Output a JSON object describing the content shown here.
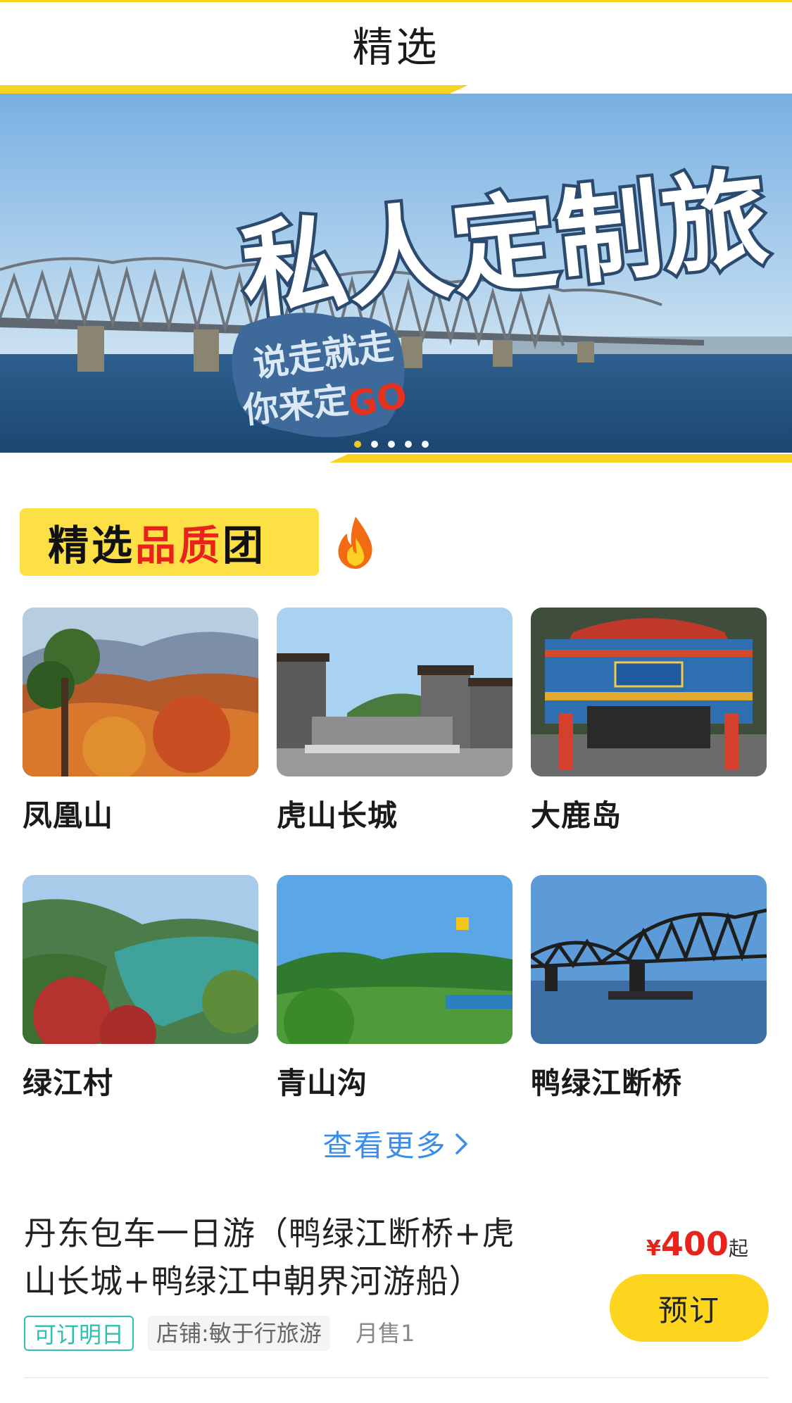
{
  "header": {
    "title": "精选"
  },
  "banner": {
    "main_text": "私人定制旅",
    "sub_text_1": "说走就走",
    "sub_text_2": "你来定",
    "go_text": "GO",
    "slide_count": 5,
    "active_slide": 1
  },
  "section": {
    "title_part1": "精选",
    "title_part2": "品质",
    "title_part3": "团"
  },
  "destinations": [
    {
      "name": "凤凰山",
      "image": "autumn-mountain"
    },
    {
      "name": "虎山长城",
      "image": "great-wall-gate"
    },
    {
      "name": "大鹿岛",
      "image": "ornate-archway"
    },
    {
      "name": "绿江村",
      "image": "river-valley"
    },
    {
      "name": "青山沟",
      "image": "green-hills"
    },
    {
      "name": "鸭绿江断桥",
      "image": "steel-bridge"
    }
  ],
  "more_link": {
    "label": "查看更多"
  },
  "product": {
    "title": "丹东包车一日游（鸭绿江断桥+虎山长城+鸭绿江中朝界河游船）",
    "price_currency": "¥",
    "price_value": "400",
    "price_suffix": "起",
    "book_label": "预订",
    "tag_tomorrow": "可订明日",
    "shop": "店铺:敏于行旅游",
    "sales": "月售1"
  },
  "colors": {
    "accent_yellow": "#f7d21e",
    "price_red": "#e8231b",
    "link_blue": "#3c8de8",
    "tag_teal": "#2fbfb0"
  }
}
